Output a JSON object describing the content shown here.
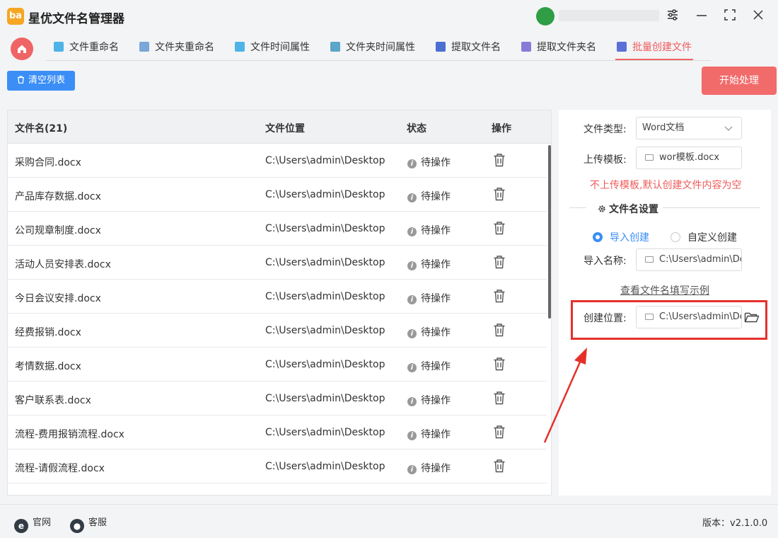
{
  "app": {
    "title": "星优文件名管理器",
    "logo_text": "ba"
  },
  "tabs": [
    {
      "label": "文件重命名",
      "icon": "rename-icon"
    },
    {
      "label": "文件夹重命名",
      "icon": "folder-rename-icon"
    },
    {
      "label": "文件时间属性",
      "icon": "file-time-icon"
    },
    {
      "label": "文件夹时间属性",
      "icon": "folder-time-icon"
    },
    {
      "label": "提取文件名",
      "icon": "extract-filename-icon"
    },
    {
      "label": "提取文件夹名",
      "icon": "extract-foldername-icon"
    },
    {
      "label": "批量创建文件",
      "icon": "batch-create-icon",
      "active": true
    }
  ],
  "toolbar": {
    "clear_label": "清空列表",
    "start_label": "开始处理"
  },
  "table": {
    "columns": [
      "文件名(21)",
      "文件位置",
      "状态",
      "操作"
    ],
    "rows": [
      {
        "name": "采购合同.docx",
        "location": "C:\\Users\\admin\\Desktop",
        "status": "待操作"
      },
      {
        "name": "产品库存数据.docx",
        "location": "C:\\Users\\admin\\Desktop",
        "status": "待操作"
      },
      {
        "name": "公司规章制度.docx",
        "location": "C:\\Users\\admin\\Desktop",
        "status": "待操作"
      },
      {
        "name": "活动人员安排表.docx",
        "location": "C:\\Users\\admin\\Desktop",
        "status": "待操作"
      },
      {
        "name": "今日会议安排.docx",
        "location": "C:\\Users\\admin\\Desktop",
        "status": "待操作"
      },
      {
        "name": "经费报销.docx",
        "location": "C:\\Users\\admin\\Desktop",
        "status": "待操作"
      },
      {
        "name": "考情数据.docx",
        "location": "C:\\Users\\admin\\Desktop",
        "status": "待操作"
      },
      {
        "name": "客户联系表.docx",
        "location": "C:\\Users\\admin\\Desktop",
        "status": "待操作"
      },
      {
        "name": "流程-费用报销流程.docx",
        "location": "C:\\Users\\admin\\Desktop",
        "status": "待操作"
      },
      {
        "name": "流程-请假流程.docx",
        "location": "C:\\Users\\admin\\Desktop",
        "status": "待操作"
      }
    ]
  },
  "panel": {
    "file_type_label": "文件类型:",
    "file_type_value": "Word文档",
    "template_label": "上传模板:",
    "template_value": "wor模板.docx",
    "warning": "不上传模板,默认创建文件内容为空",
    "section_title": "文件名设置",
    "radio_import": "导入创建",
    "radio_custom": "自定义创建",
    "import_name_label": "导入名称:",
    "import_name_value": "C:\\Users\\admin\\De",
    "example_link": "查看文件名填写示例",
    "create_location_label": "创建位置:",
    "create_location_value": "C:\\Users\\admin\\Des"
  },
  "footer": {
    "website": "官网",
    "service": "客服",
    "version": "版本：v2.1.0.0"
  },
  "colors": {
    "accent_red": "#ef6464",
    "accent_blue": "#3a8ef6",
    "annotation_red": "#e5302a"
  }
}
